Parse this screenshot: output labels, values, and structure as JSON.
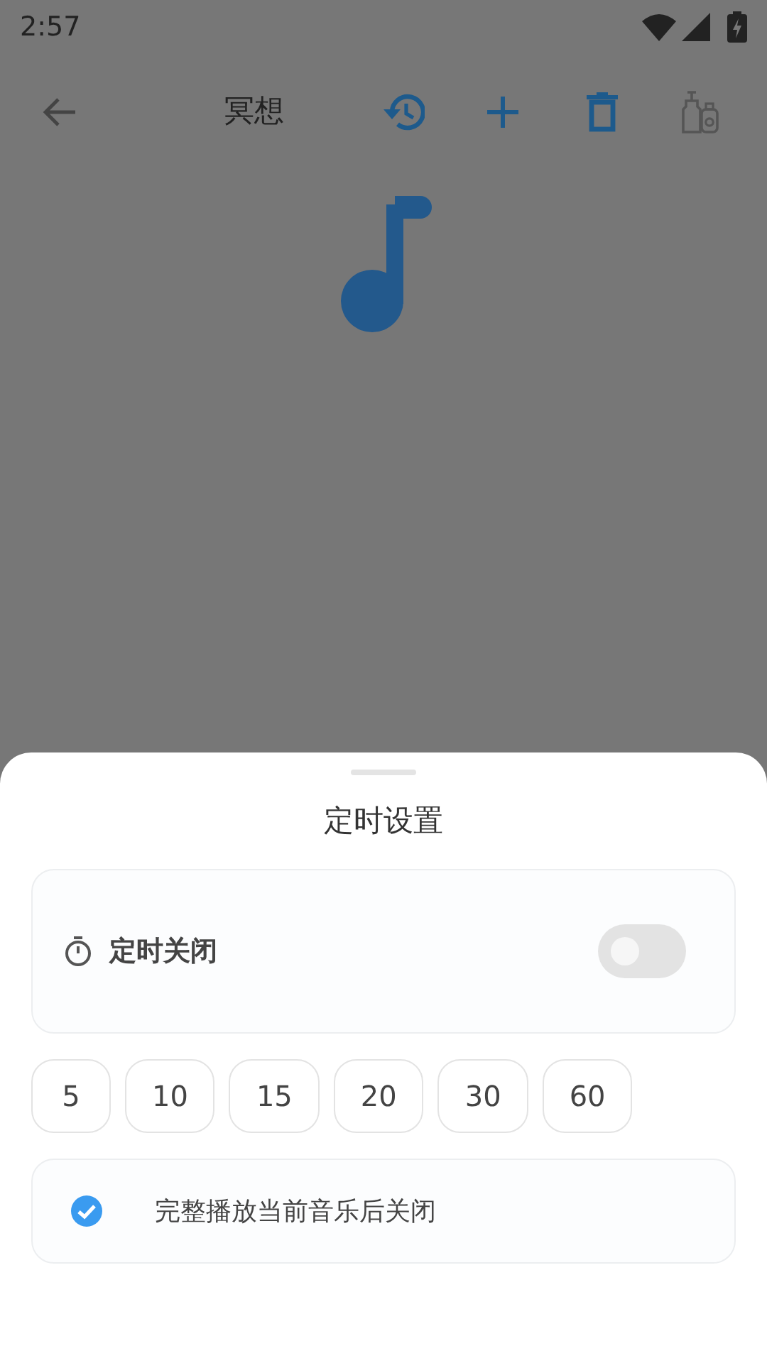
{
  "status_bar": {
    "time": "2:57"
  },
  "toolbar": {
    "title": "冥想"
  },
  "sheet": {
    "title": "定时设置",
    "timer": {
      "label": "定时关闭",
      "on": false
    },
    "durations": [
      {
        "label": "5",
        "selected": false
      },
      {
        "label": "10",
        "selected": false
      },
      {
        "label": "15",
        "selected": false
      },
      {
        "label": "20",
        "selected": false
      },
      {
        "label": "30",
        "selected": false
      },
      {
        "label": "60",
        "selected": false
      }
    ],
    "finish_option": {
      "label": "完整播放当前音乐后关闭",
      "checked": true
    }
  }
}
